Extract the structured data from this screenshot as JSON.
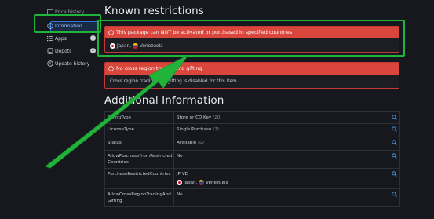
{
  "sidebar": {
    "items": [
      {
        "label": "Price history",
        "icon": "chart-icon"
      },
      {
        "label": "Information",
        "icon": "info-icon",
        "active": true
      },
      {
        "label": "Apps",
        "icon": "list-icon",
        "badge": "1"
      },
      {
        "label": "Depots",
        "icon": "box-icon",
        "badge": "2"
      },
      {
        "label": "Update history",
        "icon": "clock-icon"
      }
    ]
  },
  "restrictions": {
    "title": "Known restrictions",
    "box1": {
      "header": "This package can NOT be activated or purchased in specified countries",
      "country1": "Japan",
      "country2": "Venezuela"
    },
    "box2": {
      "header": "No cross region trading and gifting",
      "body": "Cross region trading and gifting is disabled for this item."
    }
  },
  "additional": {
    "title": "Additional Information",
    "rows": [
      {
        "key": "BillingType",
        "value": "Store or CD Key",
        "extra": "(10)"
      },
      {
        "key": "LicenseType",
        "value": "Single Purchase",
        "extra": "(1)"
      },
      {
        "key": "Status",
        "value": "Available",
        "extra": "(0)"
      },
      {
        "key": "AllowPurchaseFromRestricted Countries",
        "value": "No",
        "extra": ""
      },
      {
        "key": "PurchaseRestrictedCountries",
        "value": "JP VE",
        "extra": "",
        "country1": "Japan",
        "country2": "Venezuela"
      },
      {
        "key": "AllowCrossRegionTradingAnd Gifting",
        "value": "No",
        "extra": ""
      }
    ]
  },
  "colors": {
    "accent_green": "#1fb53a",
    "danger": "#d9463c",
    "link": "#8cc2ff"
  }
}
